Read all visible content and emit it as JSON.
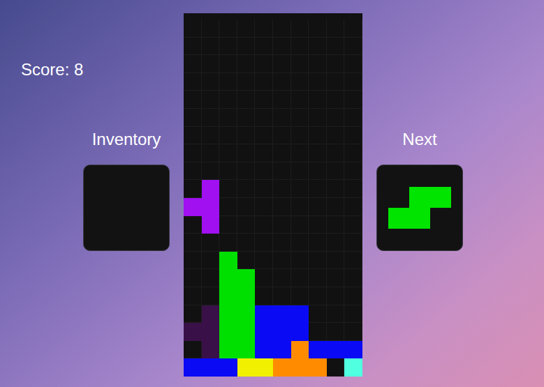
{
  "score": {
    "text": "Score: 8"
  },
  "inventory": {
    "label": "Inventory",
    "shape": []
  },
  "next": {
    "label": "Next",
    "shape": [
      ".SS",
      "SS."
    ]
  },
  "board": {
    "rows": [
      "..........",
      "..........",
      "..........",
      "..........",
      "..........",
      "..........",
      "..........",
      "..........",
      "..........",
      ".T........",
      "TT........",
      ".T........",
      "..........",
      "..G.......",
      "..GG......",
      "..GG......",
      ".gGGBBB...",
      "ggGGBBB...",
      ".gGGBBOBBB",
      "BBBYYOOO.C"
    ]
  },
  "legend": [
    {
      "key": "T",
      "color": "#a010f0"
    },
    {
      "key": "g",
      "color": "#3a1048"
    },
    {
      "key": "G",
      "color": "#00e000"
    },
    {
      "key": "S",
      "color": "#00e400"
    },
    {
      "key": "B",
      "color": "#0a0af5"
    },
    {
      "key": "O",
      "color": "#ff8c00"
    },
    {
      "key": "Y",
      "color": "#f0f000"
    },
    {
      "key": "C",
      "color": "#50ffe0"
    }
  ]
}
